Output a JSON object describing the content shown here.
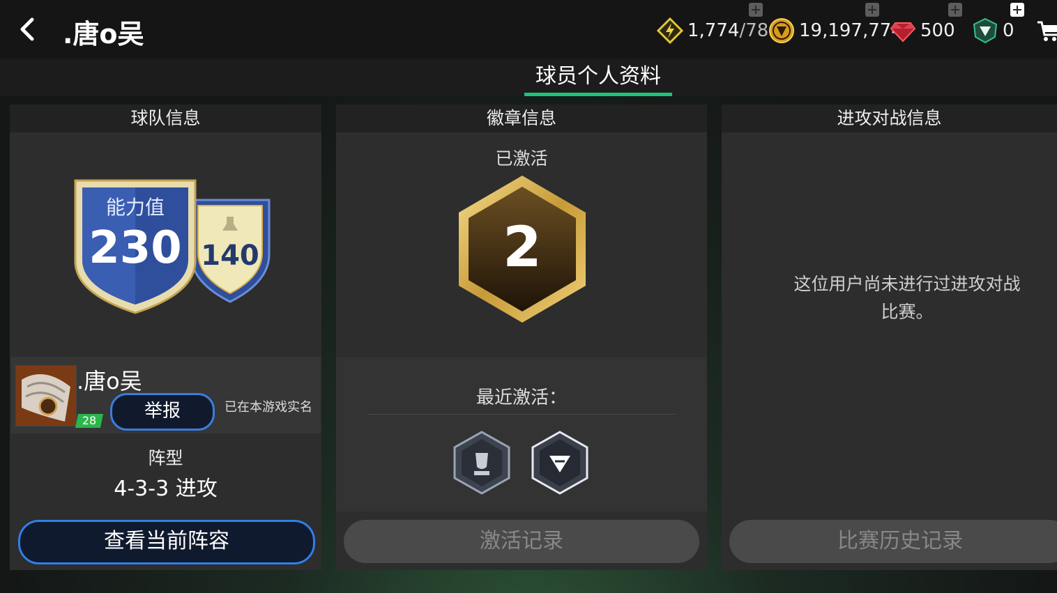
{
  "header": {
    "title": ".唐o吴",
    "energy": {
      "value": "1,774",
      "max": "/78"
    },
    "coins": "19,197,774",
    "gems": "500",
    "tokens": "0"
  },
  "tabs": [
    {
      "label": "球员个人资料",
      "active": true
    }
  ],
  "team_panel": {
    "heading": "球队信息",
    "ability_label": "能力值",
    "ability_value": "230",
    "sub_value": "140",
    "user_name": ".唐o吴",
    "level": "28",
    "report_label": "举报",
    "verified_text": "已在本游戏实名",
    "formation_label": "阵型",
    "formation_value": "4-3-3 进攻",
    "view_button": "查看当前阵容"
  },
  "badge_panel": {
    "heading": "徽章信息",
    "activated_label": "已激活",
    "badge_number": "2",
    "recent_label": "最近激活：",
    "log_button": "激活记录"
  },
  "battle_panel": {
    "heading": "进攻对战信息",
    "empty_line1": "这位用户尚未进行过进攻对战",
    "empty_line2": "比赛。",
    "history_button": "比赛历史记录"
  },
  "colors": {
    "accent_green": "#1ec37a",
    "button_blue": "#2f80e8",
    "gold": "#d9b24a",
    "shield_blue": "#2f4f9c"
  },
  "icons": [
    "back-arrow-icon",
    "lightning-icon",
    "coin-icon",
    "ruby-icon",
    "shield-token-icon",
    "cart-icon",
    "plus-icon"
  ]
}
